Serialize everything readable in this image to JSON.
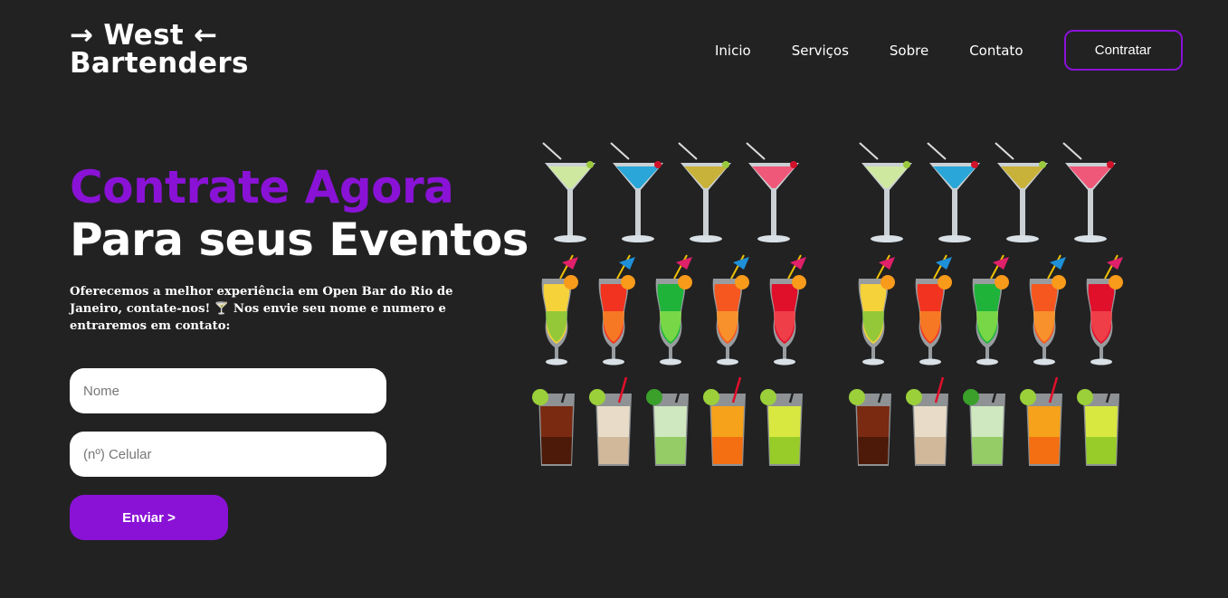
{
  "brand": {
    "line1": "→ West ←",
    "line2": "Bartenders"
  },
  "nav": {
    "items": [
      {
        "label": "Inicio"
      },
      {
        "label": "Serviços"
      },
      {
        "label": "Sobre"
      },
      {
        "label": "Contato"
      }
    ],
    "cta_label": "Contratar"
  },
  "hero": {
    "title_accent": "Contrate Agora",
    "title_main": "Para seus Eventos",
    "description": "Oferecemos a melhor experiência em Open Bar do Rio de Janeiro, contate-nos! 🍸 Nos envie seu nome e numero e entraremos em contato:"
  },
  "form": {
    "name_placeholder": "Nome",
    "phone_placeholder": "(nº) Celular",
    "submit_label": "Enviar >"
  },
  "colors": {
    "background": "#222223",
    "accent": "#8a12d6",
    "text": "#ffffff"
  }
}
